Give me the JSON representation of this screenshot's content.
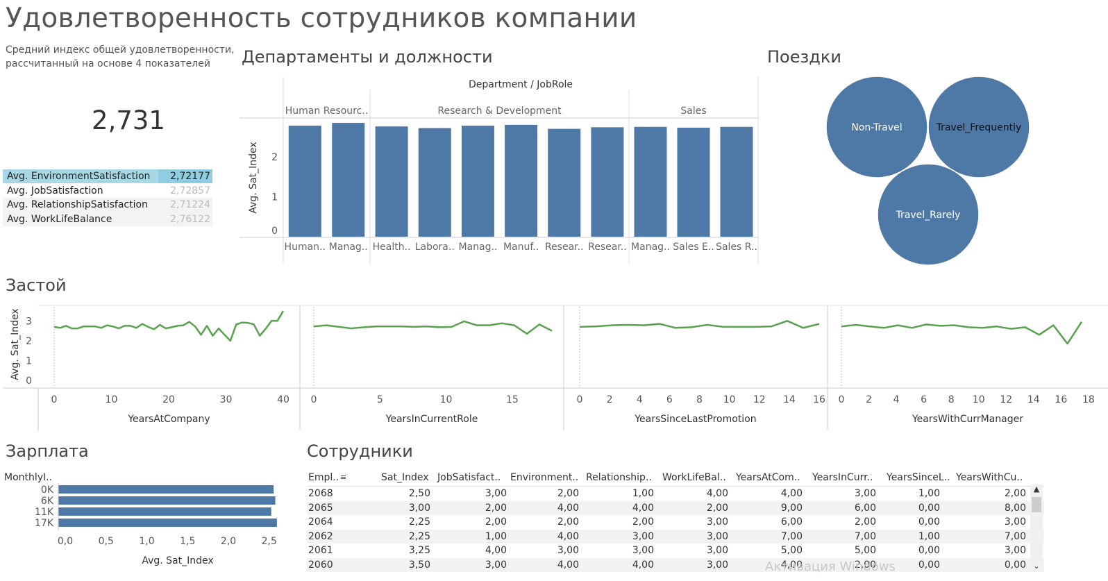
{
  "title": "Удовлетворенность сотрудников компании",
  "kpi": {
    "subtitle": "Средний индекс общей удовлетворенности, рассчитанный на основе 4 показателей",
    "value": "2,731",
    "rows": [
      {
        "label": "Avg. EnvironmentSatisfaction",
        "value": "2,72177"
      },
      {
        "label": "Avg. JobSatisfaction",
        "value": "2,72857"
      },
      {
        "label": "Avg. RelationshipSatisfaction",
        "value": "2,71224"
      },
      {
        "label": "Avg. WorkLifeBalance",
        "value": "2,76122"
      }
    ]
  },
  "sections": {
    "departments": "Департаменты и должности",
    "travel": "Поездки",
    "stagnation": "Застой",
    "salary": "Зарплата",
    "employees": "Сотрудники"
  },
  "colors": {
    "bar": "#4e79a7",
    "line": "#59a14f",
    "highlight": "#a6d7e4"
  },
  "chart_data": [
    {
      "type": "bar",
      "id": "departments",
      "header": "Department  /  JobRole",
      "ylabel": "Avg. Sat_Index",
      "ylim": [
        0,
        2.85
      ],
      "yticks": [
        0,
        1,
        2
      ],
      "groups": [
        {
          "name": "Human Resourc..",
          "roles": [
            {
              "label": "Human..",
              "value": 2.78
            },
            {
              "label": "Manag..",
              "value": 2.85
            }
          ]
        },
        {
          "name": "Research & Development",
          "roles": [
            {
              "label": "Health..",
              "value": 2.76
            },
            {
              "label": "Labora..",
              "value": 2.72
            },
            {
              "label": "Manag..",
              "value": 2.78
            },
            {
              "label": "Manuf..",
              "value": 2.8
            },
            {
              "label": "Resear..",
              "value": 2.7
            },
            {
              "label": "Resear..",
              "value": 2.74
            }
          ]
        },
        {
          "name": "Sales",
          "roles": [
            {
              "label": "Manag..",
              "value": 2.75
            },
            {
              "label": "Sales E..",
              "value": 2.73
            },
            {
              "label": "Sales R..",
              "value": 2.75
            }
          ]
        }
      ]
    },
    {
      "type": "bubble",
      "id": "travel",
      "items": [
        "Non-Travel",
        "Travel_Frequently",
        "Travel_Rarely"
      ]
    },
    {
      "type": "line",
      "id": "stagnation",
      "ylabel": "Avg. Sat_Index",
      "ylim": [
        0,
        3.5
      ],
      "yticks": [
        0,
        1,
        2,
        3
      ],
      "panels": [
        {
          "xlabel": "YearsAtCompany",
          "xlim": [
            0,
            40
          ],
          "xticks": [
            0,
            10,
            20,
            30,
            40
          ],
          "x": [
            0,
            1,
            2,
            3,
            4,
            5,
            6,
            7,
            8,
            9,
            10,
            11,
            12,
            13,
            14,
            15,
            16,
            17,
            18,
            19,
            20,
            21,
            22,
            23,
            24,
            25,
            26,
            27,
            28,
            29,
            30,
            31,
            32,
            33,
            34,
            35,
            36,
            37,
            38,
            40
          ],
          "y": [
            2.7,
            2.65,
            2.75,
            2.62,
            2.62,
            2.72,
            2.72,
            2.72,
            2.65,
            2.78,
            2.72,
            2.62,
            2.75,
            2.75,
            2.65,
            2.85,
            2.7,
            2.58,
            2.8,
            2.62,
            2.68,
            2.75,
            2.78,
            2.95,
            2.72,
            2.3,
            2.75,
            2.25,
            2.62,
            2.3,
            2.0,
            2.82,
            2.92,
            2.9,
            2.82,
            2.25,
            2.6,
            3.0,
            3.0,
            3.5
          ]
        },
        {
          "xlabel": "YearsInCurrentRole",
          "xlim": [
            0,
            18
          ],
          "xticks": [
            0,
            5,
            10,
            15
          ],
          "x": [
            0,
            1,
            2,
            3,
            4,
            5,
            6,
            7,
            8,
            9,
            10,
            11,
            12,
            13,
            14,
            15,
            16,
            17,
            18
          ],
          "y": [
            2.72,
            2.78,
            2.7,
            2.62,
            2.68,
            2.72,
            2.72,
            2.72,
            2.7,
            2.72,
            2.68,
            2.7,
            2.98,
            2.78,
            2.78,
            2.88,
            2.78,
            2.35,
            2.82,
            2.5
          ]
        },
        {
          "xlabel": "YearsSinceLastPromotion",
          "xlim": [
            0,
            16
          ],
          "xticks": [
            0,
            2,
            4,
            6,
            8,
            10,
            12,
            14,
            16
          ],
          "x": [
            0,
            1,
            2,
            3,
            4,
            5,
            6,
            7,
            8,
            9,
            10,
            11,
            12,
            13,
            14,
            15
          ],
          "y": [
            2.7,
            2.72,
            2.78,
            2.8,
            2.78,
            2.85,
            2.65,
            2.68,
            2.8,
            2.7,
            2.7,
            2.7,
            2.72,
            3.0,
            2.65,
            2.85
          ]
        },
        {
          "xlabel": "YearsWithCurrManager",
          "xlim": [
            0,
            17.5
          ],
          "xticks": [
            0,
            2,
            4,
            6,
            8,
            10,
            12,
            14,
            16,
            18
          ],
          "x": [
            0,
            1,
            2,
            3,
            4,
            5,
            6,
            7,
            8,
            9,
            10,
            11,
            12,
            13,
            14,
            15,
            16,
            17
          ],
          "y": [
            2.72,
            2.8,
            2.72,
            2.65,
            2.78,
            2.65,
            2.82,
            2.75,
            2.78,
            2.68,
            2.65,
            2.72,
            2.6,
            2.68,
            2.3,
            2.78,
            1.85,
            2.95
          ]
        }
      ]
    },
    {
      "type": "bar",
      "id": "salary",
      "orientation": "horizontal",
      "header": "MonthlyI..",
      "xlabel": "Avg. Sat_Index",
      "xlim": [
        0,
        2.8
      ],
      "xticks": [
        "0,0",
        "0,5",
        "1,0",
        "1,5",
        "2,0",
        "2,5"
      ],
      "categories": [
        "0K",
        "6K",
        "11K",
        "17K"
      ],
      "values": [
        2.64,
        2.66,
        2.61,
        2.68
      ]
    }
  ],
  "employees": {
    "columns": [
      "Empl..",
      "Sat_Index",
      "JobSatisfact..",
      "Environment..",
      "Relationship..",
      "WorkLifeBal..",
      "YearsAtCom..",
      "YearsInCurr..",
      "YearsSinceL..",
      "YearsWithCu.."
    ],
    "rows": [
      [
        "2068",
        "2,50",
        "3,00",
        "2,00",
        "1,00",
        "4,00",
        "4,00",
        "3,00",
        "1,00",
        "2,00"
      ],
      [
        "2065",
        "3,00",
        "2,00",
        "4,00",
        "4,00",
        "2,00",
        "9,00",
        "6,00",
        "0,00",
        "8,00"
      ],
      [
        "2064",
        "2,25",
        "2,00",
        "2,00",
        "2,00",
        "3,00",
        "6,00",
        "2,00",
        "0,00",
        "3,00"
      ],
      [
        "2062",
        "2,25",
        "1,00",
        "4,00",
        "3,00",
        "3,00",
        "7,00",
        "7,00",
        "1,00",
        "7,00"
      ],
      [
        "2061",
        "3,25",
        "4,00",
        "3,00",
        "3,00",
        "3,00",
        "5,00",
        "5,00",
        "0,00",
        "3,00"
      ],
      [
        "2060",
        "3,50",
        "3,00",
        "4,00",
        "4,00",
        "3,00",
        "4,00",
        "2,00",
        "0,00",
        "0,00"
      ]
    ]
  },
  "watermark": "Активация Windows"
}
